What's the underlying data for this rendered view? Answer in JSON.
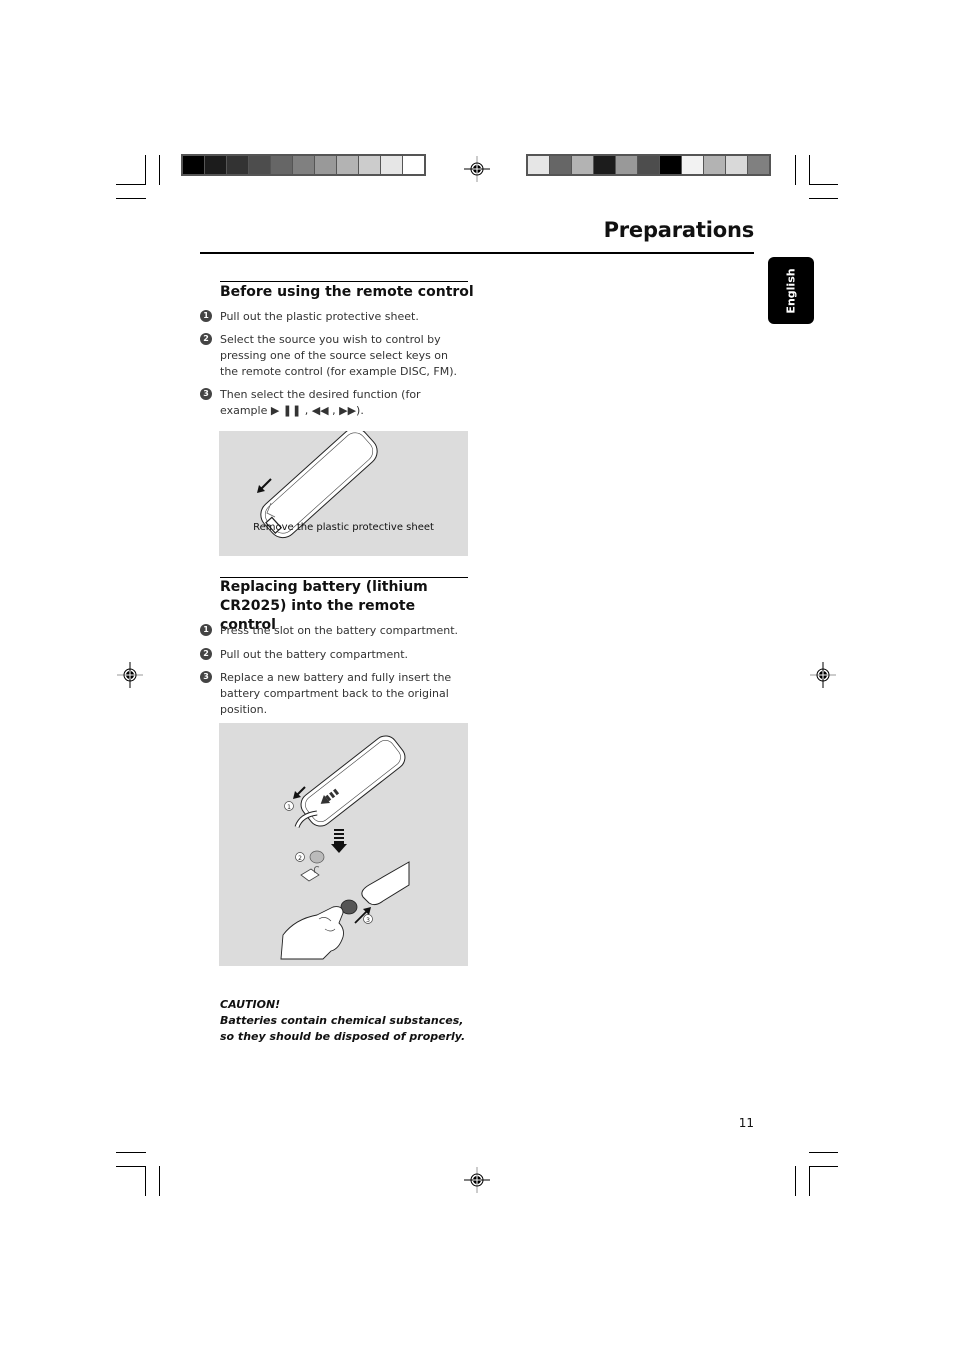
{
  "header": {
    "title": "Preparations",
    "language_tab": "English"
  },
  "print_marks": {
    "left_colorbar": [
      "#000000",
      "#1c1c1c",
      "#333333",
      "#4d4d4d",
      "#666666",
      "#808080",
      "#999999",
      "#b3b3b3",
      "#cccccc",
      "#e6e6e6",
      "#ffffff"
    ],
    "right_colorbar": [
      "#e6e6e6",
      "#666666",
      "#b3b3b3",
      "#1c1c1c",
      "#999999",
      "#4d4d4d",
      "#000000",
      "#f2f2f2",
      "#b3b3b3",
      "#d9d9d9",
      "#808080"
    ],
    "registration_icon": "crosshair-target-icon"
  },
  "sections": [
    {
      "heading": "Before using the remote control",
      "steps": [
        {
          "num": "1",
          "text": "Pull out the plastic protective sheet."
        },
        {
          "num": "2",
          "text": "Select the source you wish to control by pressing one of the source select keys on the remote control (for example DISC, FM)."
        },
        {
          "num": "3",
          "text": "Then select the desired function (for example ▶ ❚❚ ,   ◀◀ , ▶▶)."
        }
      ],
      "figure": {
        "caption": "Remove the plastic protective sheet",
        "illustration": "remote-control-pull-sheet-illustration"
      }
    },
    {
      "heading": "Replacing battery (lithium CR2025) into the remote control",
      "steps": [
        {
          "num": "1",
          "text": "Press the slot on the battery compartment."
        },
        {
          "num": "2",
          "text": "Pull out the battery compartment."
        },
        {
          "num": "3",
          "text": "Replace a new battery and fully insert the battery compartment back to the original position."
        }
      ],
      "figure": {
        "illustration": "battery-replacement-illustration",
        "callouts": [
          "1",
          "2",
          "3"
        ]
      }
    }
  ],
  "caution": {
    "title": "CAUTION!",
    "text": "Batteries contain chemical substances, so they should be disposed of properly."
  },
  "footer": {
    "page_number": "11"
  }
}
